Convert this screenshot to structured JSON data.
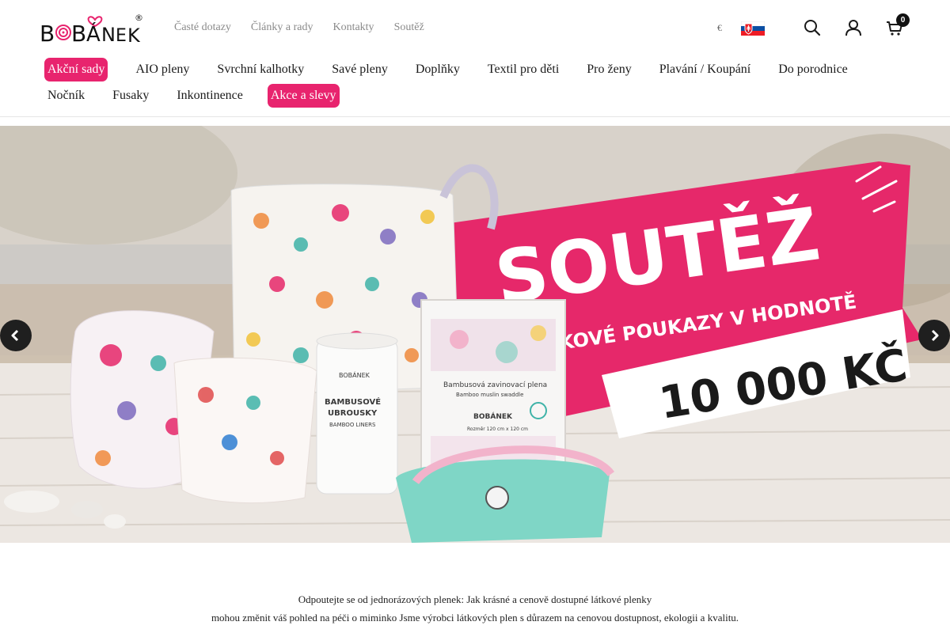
{
  "brand": {
    "name": "BOBÁNEK",
    "registered_mark": "®",
    "logo_letters": [
      "B",
      "O",
      "B",
      "Á",
      "N",
      "E",
      "K"
    ]
  },
  "top_links": [
    "Časté dotazy",
    "Články a rady",
    "Kontakty",
    "Soutěž"
  ],
  "header": {
    "currency": "€",
    "flag": "slovakia-flag",
    "icons": [
      "search-icon",
      "user-icon",
      "cart-icon"
    ],
    "cart_count": "0"
  },
  "nav": {
    "row1": [
      {
        "label": "Akční sady",
        "highlight": true
      },
      {
        "label": "AIO pleny",
        "highlight": false
      },
      {
        "label": "Svrchní kalhotky",
        "highlight": false
      },
      {
        "label": "Savé pleny",
        "highlight": false
      },
      {
        "label": "Doplňky",
        "highlight": false
      },
      {
        "label": "Textil pro děti",
        "highlight": false
      },
      {
        "label": "Pro ženy",
        "highlight": false
      },
      {
        "label": "Plavání / Koupání",
        "highlight": false
      },
      {
        "label": "Do porodnice",
        "highlight": false
      }
    ],
    "row2": [
      {
        "label": "Nočník",
        "highlight": false
      },
      {
        "label": "Fusaky",
        "highlight": false
      },
      {
        "label": "Inkontinence",
        "highlight": false
      },
      {
        "label": "Akce a slevy",
        "highlight": true
      }
    ]
  },
  "hero": {
    "title": "SOUTĚŽ",
    "subtitle": "O DÁRKOVÉ POUKAZY V HODNOTĚ",
    "amount": "10 000 KČ",
    "package_brand": "BOBÁNEK",
    "roll_title_1": "BAMBUSOVÉ",
    "roll_title_2": "UBROUSKY",
    "roll_subtitle": "BAMBOO LINERS",
    "box_title": "Bambusová zavinovací plena",
    "box_subtitle": "Bamboo muslin swaddle",
    "box_size": "Rozměr 120 cm x 120 cm"
  },
  "carousel": {
    "prev": "chevron-left-icon",
    "next": "chevron-right-icon"
  },
  "colors": {
    "accent": "#e8246e",
    "banner": "#e6286a",
    "dark": "#1f1f1f",
    "muted_text": "#8a8a8a"
  },
  "intro": {
    "line1": "Odpoutejte se od jednorázových plenek: Jak krásné a cenově dostupné látkové plenky",
    "line2": "mohou změnit váš pohled na péči o miminko Jsme výrobci látkových plen s důrazem na cenovou dostupnost, ekologii a kvalitu."
  }
}
